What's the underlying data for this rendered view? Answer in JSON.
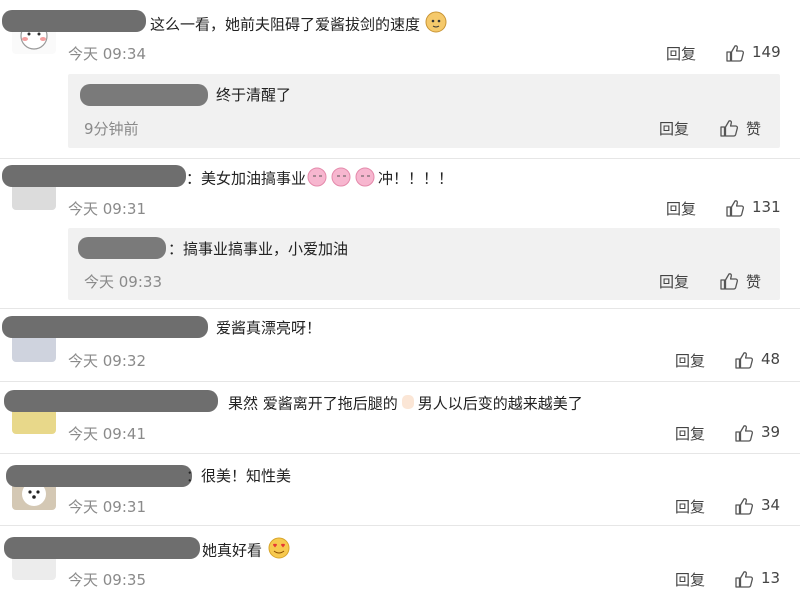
{
  "comments": [
    {
      "text": "这么一看，她前夫阻碍了爱酱拔剑的速度",
      "time": "今天 09:34",
      "reply": "回复",
      "likes": "149"
    },
    {
      "text": "：美女加油搞事业",
      "text_after": "冲！！！！",
      "time": "今天 09:31",
      "reply": "回复",
      "likes": "131"
    },
    {
      "text": "爱酱真漂亮呀！",
      "time": "今天 09:32",
      "reply": "回复",
      "likes": "48"
    },
    {
      "text": "果然 爱酱离开了拖后腿的",
      "text_after": "男人以后变的越来越美了",
      "time": "今天 09:41",
      "reply": "回复",
      "likes": "39"
    },
    {
      "text": "：很美！知性美",
      "time": "今天 09:31",
      "reply": "回复",
      "likes": "34"
    },
    {
      "text": "她真好看",
      "time": "今天 09:35",
      "reply": "回复",
      "likes": "13"
    }
  ],
  "subreplies": [
    {
      "text": "终于清醒了",
      "time": "9分钟前",
      "reply": "回复",
      "likes": "赞"
    },
    {
      "text": "：搞事业搞事业，小爱加油",
      "time": "今天 09:33",
      "reply": "回复",
      "likes": "赞"
    }
  ],
  "icons": {
    "like": "thumbs-up-icon"
  },
  "colors": {
    "redaction": "#6e6e6e",
    "subbox": "#f1f1f1",
    "meta": "#8a8a8a"
  }
}
